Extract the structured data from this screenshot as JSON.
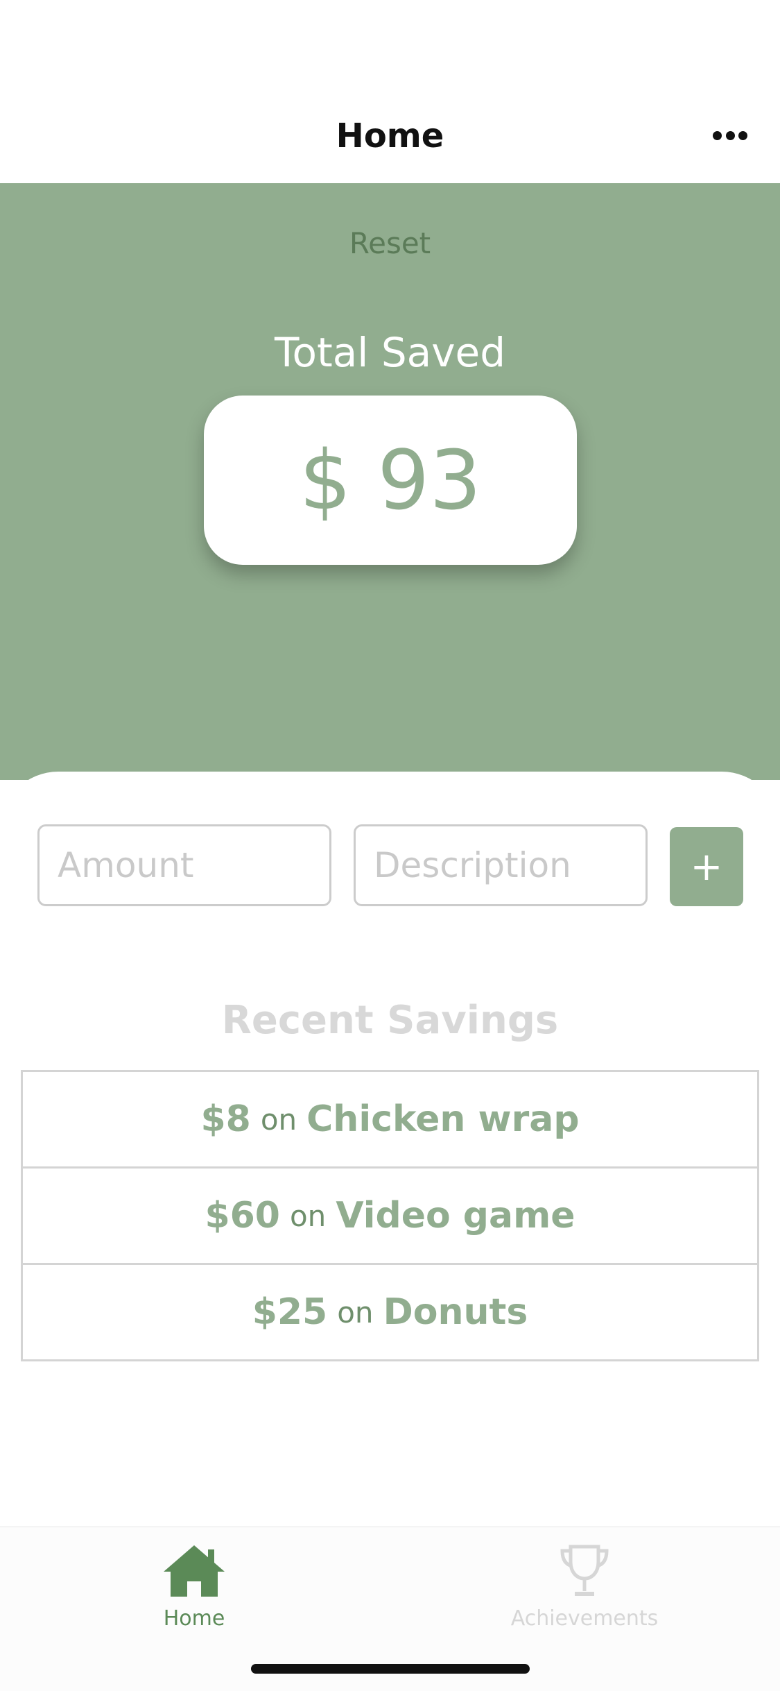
{
  "header": {
    "title": "Home",
    "more_icon": "ellipsis-icon"
  },
  "hero": {
    "reset_label": "Reset",
    "total_label": "Total Saved",
    "total_value": "$ 93",
    "background": "#91ad8f"
  },
  "form": {
    "amount_placeholder": "Amount",
    "description_placeholder": "Description",
    "add_label": "+"
  },
  "recent": {
    "title": "Recent Savings",
    "connector": "on",
    "items": [
      {
        "amount": "$8",
        "description": "Chicken wrap"
      },
      {
        "amount": "$60",
        "description": "Video game"
      },
      {
        "amount": "$25",
        "description": "Donuts"
      }
    ]
  },
  "tabs": [
    {
      "label": "Home",
      "icon": "home-icon",
      "active": true
    },
    {
      "label": "Achievements",
      "icon": "trophy-icon",
      "active": false
    }
  ],
  "colors": {
    "accent": "#91ad8f",
    "accent_dark": "#5b8a57",
    "muted": "#d6d6d6"
  }
}
